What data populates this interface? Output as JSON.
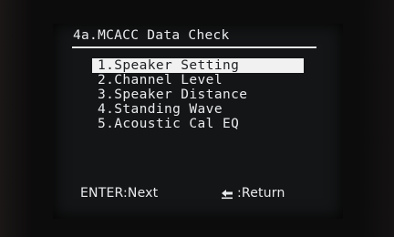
{
  "screen": {
    "title": "4a.MCACC Data Check",
    "menu_items": [
      {
        "label": "1.Speaker Setting",
        "selected": true
      },
      {
        "label": "2.Channel Level",
        "selected": false
      },
      {
        "label": "3.Speaker Distance",
        "selected": false
      },
      {
        "label": "4.Standing Wave",
        "selected": false
      },
      {
        "label": "5.Acoustic Cal EQ",
        "selected": false
      }
    ],
    "footer": {
      "enter_hint": "ENTER:Next",
      "return_hint": ":Return",
      "return_icon": "return-arrow-icon"
    }
  }
}
